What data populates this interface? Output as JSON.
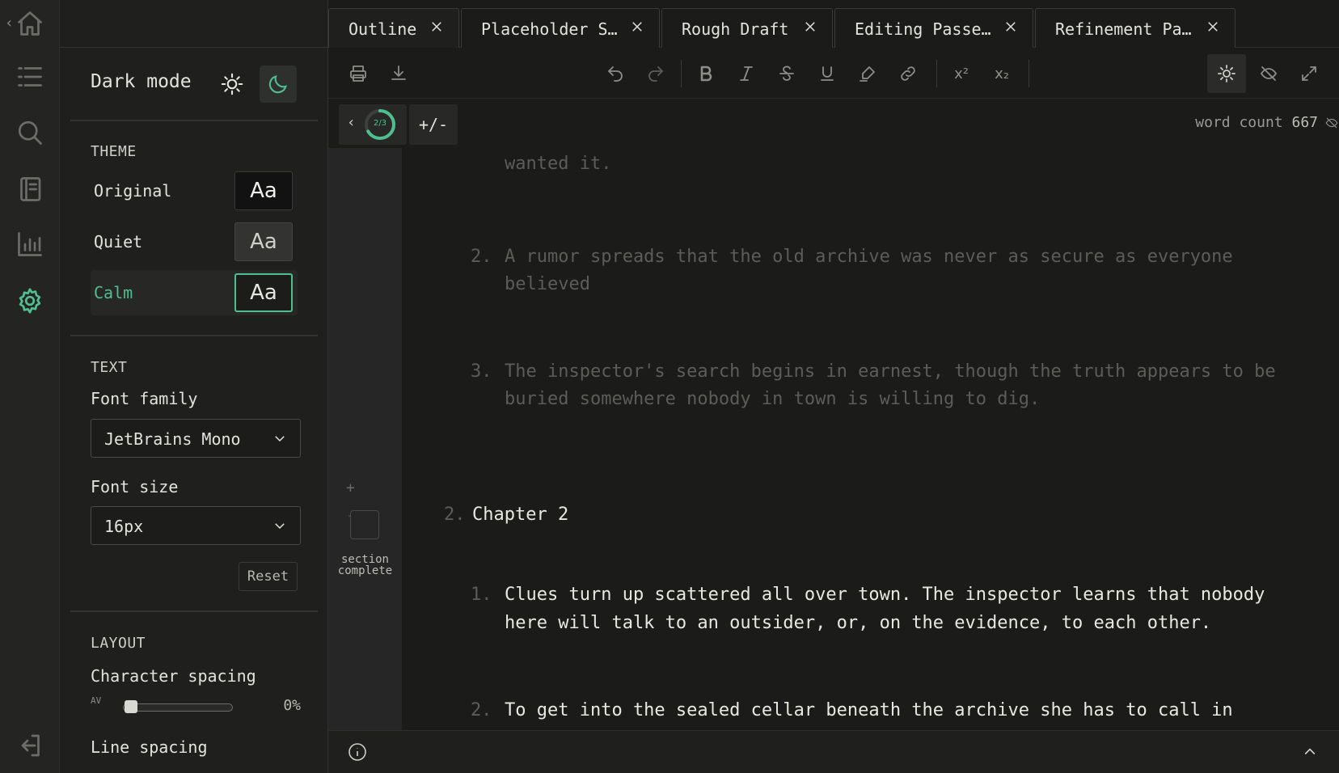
{
  "rail": {
    "items": [
      {
        "icon": "home-icon"
      },
      {
        "icon": "outline-list-icon"
      },
      {
        "icon": "search-icon"
      },
      {
        "icon": "notebook-icon"
      },
      {
        "icon": "stats-icon"
      },
      {
        "icon": "settings-gear-icon",
        "active": true
      },
      {
        "icon": "logout-icon"
      }
    ]
  },
  "panel": {
    "dark_mode_label": "Dark mode",
    "theme_title": "THEME",
    "themes": [
      {
        "name": "Original",
        "swatch": "Aa"
      },
      {
        "name": "Quiet",
        "swatch": "Aa"
      },
      {
        "name": "Calm",
        "swatch": "Aa",
        "selected": true
      }
    ],
    "text_title": "TEXT",
    "font_family_label": "Font family",
    "font_family_value": "JetBrains Mono",
    "font_size_label": "Font size",
    "font_size_value": "16px",
    "reset_label": "Reset",
    "layout_title": "LAYOUT",
    "char_spacing_label": "Character spacing",
    "char_spacing_icon_text": "AV",
    "char_spacing_value": "0%",
    "char_spacing_fraction": 0,
    "line_spacing_label": "Line spacing"
  },
  "tabs": [
    {
      "label": "Outline",
      "active": true
    },
    {
      "label": "Placeholder S…"
    },
    {
      "label": "Rough Draft"
    },
    {
      "label": "Editing Passe…"
    },
    {
      "label": "Refinement Pa…"
    }
  ],
  "toolbar": {
    "superscript": "x²",
    "subscript": "x₂"
  },
  "subbar": {
    "progress_label": "2/3",
    "progress_fraction": 0.667,
    "diff_button": "+/-",
    "word_count_label": "word count",
    "word_count_value": "667"
  },
  "editor": {
    "fragment": "wanted it.",
    "ch1_items": [
      {
        "num": "2.",
        "line1": "A rumor spreads that the old archive was never as secure as everyone",
        "line2": "believed"
      },
      {
        "num": "3.",
        "line1": "The inspector's search begins in earnest, though the truth appears to be",
        "line2": "buried somewhere nobody in town is willing to dig."
      }
    ],
    "chapter_num": "2.",
    "chapter_title": "Chapter 2",
    "ch2_items": [
      {
        "num": "1.",
        "line1": "Clues turn up scattered all over town. The inspector learns that nobody",
        "line2": "here will talk to an outsider, or, on the evidence, to each other."
      },
      {
        "num": "2.",
        "line1": "To get into the sealed cellar beneath the archive she has to call in"
      }
    ],
    "section_label_1": "section",
    "section_label_2": "complete",
    "accent": "#4fbf8f"
  }
}
